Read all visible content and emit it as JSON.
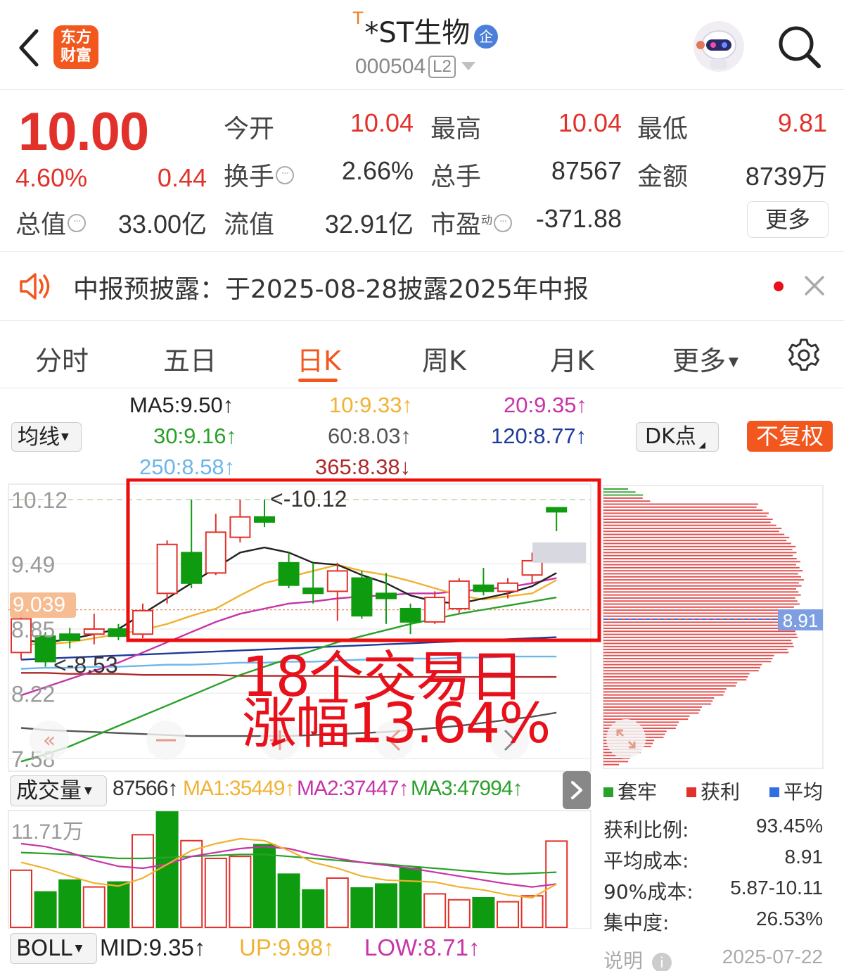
{
  "header": {
    "logo_line1": "东方",
    "logo_line2": "财富",
    "t_mark": "T",
    "stock_name": "*ST生物",
    "badge": "企",
    "code": "000504",
    "level": "L2"
  },
  "quote": {
    "price": "10.00",
    "change_pct": "4.60%",
    "change": "0.44",
    "open_label": "今开",
    "open": "10.04",
    "high_label": "最高",
    "high": "10.04",
    "low_label": "最低",
    "low": "9.81",
    "turnover_label": "换手",
    "turnover": "2.66%",
    "volume_label": "总手",
    "volume": "87567",
    "amount_label": "金额",
    "amount": "8739万",
    "mktcap_label": "总值",
    "mktcap": "33.00亿",
    "float_label": "流值",
    "float_cap": "32.91亿",
    "pe_label": "市盈",
    "pe_sup": "动",
    "pe": "-371.88",
    "more_label": "更多",
    "info_glyph": "···"
  },
  "notice": {
    "text": "中报预披露：于2025-08-28披露2025年中报"
  },
  "tabs": [
    "分时",
    "五日",
    "日K",
    "周K",
    "月K",
    "更多"
  ],
  "ma": {
    "ma5": "MA5:9.50↑",
    "ma10": "10:9.33↑",
    "ma20": "20:9.35↑",
    "ma30": "30:9.16↑",
    "ma60": "60:8.03↑",
    "ma120": "120:8.77↑",
    "ma250": "250:8.58↑",
    "ma365": "365:8.38↓",
    "selector_label": "均线",
    "dk_label": "DK点",
    "adjust_label": "不复权"
  },
  "colors": {
    "up": "#e2312b",
    "down": "#0f9b0f",
    "accent": "#f2571e",
    "ma5": "#222222",
    "ma10": "#f0b232",
    "ma20": "#c634a8",
    "ma30": "#2aa12a",
    "ma60": "#555555",
    "ma120": "#1d3a9a",
    "ma250": "#6db6ea",
    "ma365": "#b02a2a"
  },
  "chart_data": [
    {
      "type": "candlestick",
      "title": "日K",
      "y_ticks": [
        "10.12",
        "9.49",
        "8.85",
        "8.22",
        "7.58"
      ],
      "y_range": [
        7.58,
        10.12
      ],
      "price_tag": "9.039",
      "max_marker": "<-10.12",
      "min_marker": "<-8.53",
      "candles": [
        {
          "o": 8.62,
          "c": 8.95,
          "h": 9.05,
          "l": 8.55,
          "up": true
        },
        {
          "o": 8.78,
          "c": 8.53,
          "h": 8.82,
          "l": 8.48,
          "up": false
        },
        {
          "o": 8.8,
          "c": 8.74,
          "h": 8.86,
          "l": 8.66,
          "up": false
        },
        {
          "o": 8.8,
          "c": 8.85,
          "h": 9.0,
          "l": 8.7,
          "up": true
        },
        {
          "o": 8.85,
          "c": 8.78,
          "h": 8.9,
          "l": 8.74,
          "up": false
        },
        {
          "o": 8.8,
          "c": 9.03,
          "h": 9.1,
          "l": 8.76,
          "up": true
        },
        {
          "o": 9.2,
          "c": 9.68,
          "h": 9.72,
          "l": 9.1,
          "up": true
        },
        {
          "o": 9.6,
          "c": 9.3,
          "h": 10.12,
          "l": 9.25,
          "up": false
        },
        {
          "o": 9.4,
          "c": 9.8,
          "h": 9.98,
          "l": 9.38,
          "up": true
        },
        {
          "o": 9.75,
          "c": 9.95,
          "h": 10.12,
          "l": 9.7,
          "up": true
        },
        {
          "o": 9.95,
          "c": 9.9,
          "h": 10.12,
          "l": 9.85,
          "up": false
        },
        {
          "o": 9.5,
          "c": 9.28,
          "h": 9.6,
          "l": 9.25,
          "up": false
        },
        {
          "o": 9.25,
          "c": 9.2,
          "h": 9.5,
          "l": 9.1,
          "up": false
        },
        {
          "o": 9.22,
          "c": 9.42,
          "h": 9.5,
          "l": 8.93,
          "up": true
        },
        {
          "o": 9.35,
          "c": 8.98,
          "h": 9.42,
          "l": 8.95,
          "up": false
        },
        {
          "o": 9.2,
          "c": 9.15,
          "h": 9.4,
          "l": 8.9,
          "up": false
        },
        {
          "o": 9.05,
          "c": 8.92,
          "h": 9.1,
          "l": 8.8,
          "up": false
        },
        {
          "o": 8.92,
          "c": 9.16,
          "h": 9.22,
          "l": 8.9,
          "up": true
        },
        {
          "o": 9.05,
          "c": 9.32,
          "h": 9.35,
          "l": 9.0,
          "up": true
        },
        {
          "o": 9.28,
          "c": 9.22,
          "h": 9.45,
          "l": 9.18,
          "up": false
        },
        {
          "o": 9.22,
          "c": 9.3,
          "h": 9.35,
          "l": 9.15,
          "up": true
        },
        {
          "o": 9.38,
          "c": 9.52,
          "h": 9.6,
          "l": 9.3,
          "up": true
        },
        {
          "o": 10.04,
          "c": 10.0,
          "h": 10.04,
          "l": 9.81,
          "up": false
        }
      ],
      "ma_lines": {
        "ma5": [
          8.74,
          8.72,
          8.75,
          8.8,
          8.85,
          9.0,
          9.15,
          9.3,
          9.45,
          9.6,
          9.65,
          9.6,
          9.5,
          9.48,
          9.38,
          9.3,
          9.18,
          9.12,
          9.1,
          9.15,
          9.2,
          9.27,
          9.4
        ],
        "ma10": [
          8.7,
          8.7,
          8.72,
          8.76,
          8.8,
          8.84,
          8.9,
          8.98,
          9.05,
          9.18,
          9.3,
          9.36,
          9.42,
          9.48,
          9.42,
          9.38,
          9.32,
          9.25,
          9.18,
          9.14,
          9.17,
          9.2,
          9.33
        ],
        "ma20": [
          8.2,
          8.28,
          8.36,
          8.44,
          8.52,
          8.62,
          8.72,
          8.82,
          8.92,
          9.0,
          9.05,
          9.1,
          9.12,
          9.15,
          9.17,
          9.18,
          9.2,
          9.2,
          9.22,
          9.24,
          9.26,
          9.3,
          9.35
        ],
        "ma30": [
          7.55,
          7.62,
          7.7,
          7.8,
          7.9,
          8.0,
          8.1,
          8.2,
          8.3,
          8.4,
          8.48,
          8.56,
          8.64,
          8.72,
          8.78,
          8.84,
          8.9,
          8.95,
          9.0,
          9.04,
          9.08,
          9.12,
          9.16
        ],
        "ma60": [
          7.88,
          7.86,
          7.85,
          7.84,
          7.83,
          7.82,
          7.81,
          7.8,
          7.8,
          7.8,
          7.8,
          7.8,
          7.81,
          7.82,
          7.83,
          7.84,
          7.86,
          7.88,
          7.9,
          7.93,
          7.96,
          7.99,
          8.03
        ],
        "ma120": [
          8.55,
          8.56,
          8.57,
          8.58,
          8.59,
          8.6,
          8.61,
          8.62,
          8.63,
          8.64,
          8.65,
          8.66,
          8.67,
          8.68,
          8.69,
          8.7,
          8.71,
          8.72,
          8.73,
          8.74,
          8.75,
          8.76,
          8.77
        ],
        "ma250": [
          8.46,
          8.47,
          8.47,
          8.48,
          8.48,
          8.49,
          8.5,
          8.5,
          8.51,
          8.52,
          8.52,
          8.53,
          8.53,
          8.54,
          8.55,
          8.55,
          8.56,
          8.56,
          8.57,
          8.57,
          8.58,
          8.58,
          8.58
        ],
        "ma365": [
          8.42,
          8.42,
          8.41,
          8.41,
          8.41,
          8.4,
          8.4,
          8.4,
          8.4,
          8.39,
          8.39,
          8.39,
          8.39,
          8.39,
          8.38,
          8.38,
          8.38,
          8.38,
          8.38,
          8.38,
          8.38,
          8.38,
          8.38
        ]
      }
    },
    {
      "type": "bar",
      "title": "成交量",
      "y_label": "11.71万",
      "values": [
        58000,
        36000,
        48000,
        41000,
        46000,
        94000,
        117100,
        88000,
        70000,
        72000,
        84000,
        54000,
        38000,
        50000,
        40000,
        44000,
        60000,
        34000,
        28000,
        30000,
        26000,
        32000,
        87566
      ],
      "up": [
        true,
        false,
        false,
        true,
        false,
        true,
        false,
        true,
        true,
        true,
        false,
        false,
        false,
        true,
        false,
        false,
        false,
        true,
        true,
        false,
        true,
        true,
        true
      ],
      "ma1": [
        66000,
        60000,
        52000,
        45000,
        42000,
        50000,
        64000,
        78000,
        85000,
        90000,
        88000,
        78000,
        66000,
        60000,
        52000,
        48000,
        47000,
        46000,
        41000,
        38000,
        33000,
        30000,
        44000
      ],
      "ma2": [
        85000,
        82000,
        76000,
        68000,
        62000,
        60000,
        64000,
        72000,
        76000,
        80000,
        82000,
        80000,
        74000,
        70000,
        66000,
        63000,
        60000,
        56000,
        52000,
        48000,
        44000,
        41000,
        44000
      ],
      "ma3": [
        76000,
        75000,
        74000,
        72000,
        70000,
        70000,
        71000,
        72000,
        73000,
        74000,
        74000,
        72000,
        70000,
        68000,
        66000,
        64000,
        62000,
        60000,
        58000,
        56000,
        54000,
        55000,
        56000
      ]
    },
    {
      "type": "bar",
      "title": "筹码分布",
      "current_price_tag": "8.91"
    }
  ],
  "volume_header": {
    "selector_label": "成交量",
    "vol": "87566↑",
    "ma1": "MA1:35449↑",
    "ma2": "MA2:37447↑",
    "ma3": "MA3:47994↑"
  },
  "chips": {
    "legend_trapped": "套牢",
    "legend_profit": "获利",
    "legend_avg": "平均",
    "profit_ratio_label": "获利比例:",
    "profit_ratio": "93.45%",
    "avg_cost_label": "平均成本:",
    "avg_cost": "8.91",
    "cost90_label": "90%成本:",
    "cost90": "5.87-10.11",
    "concentration_label": "集中度:",
    "concentration": "26.53%",
    "explain_label": "说明",
    "date": "2025-07-22"
  },
  "boll": {
    "selector_label": "BOLL",
    "mid": "MID:9.35↑",
    "up": "UP:9.98↑",
    "low": "LOW:8.71↑"
  },
  "annotation": {
    "line1": "18个交易日",
    "line2": "涨幅13.64%"
  }
}
